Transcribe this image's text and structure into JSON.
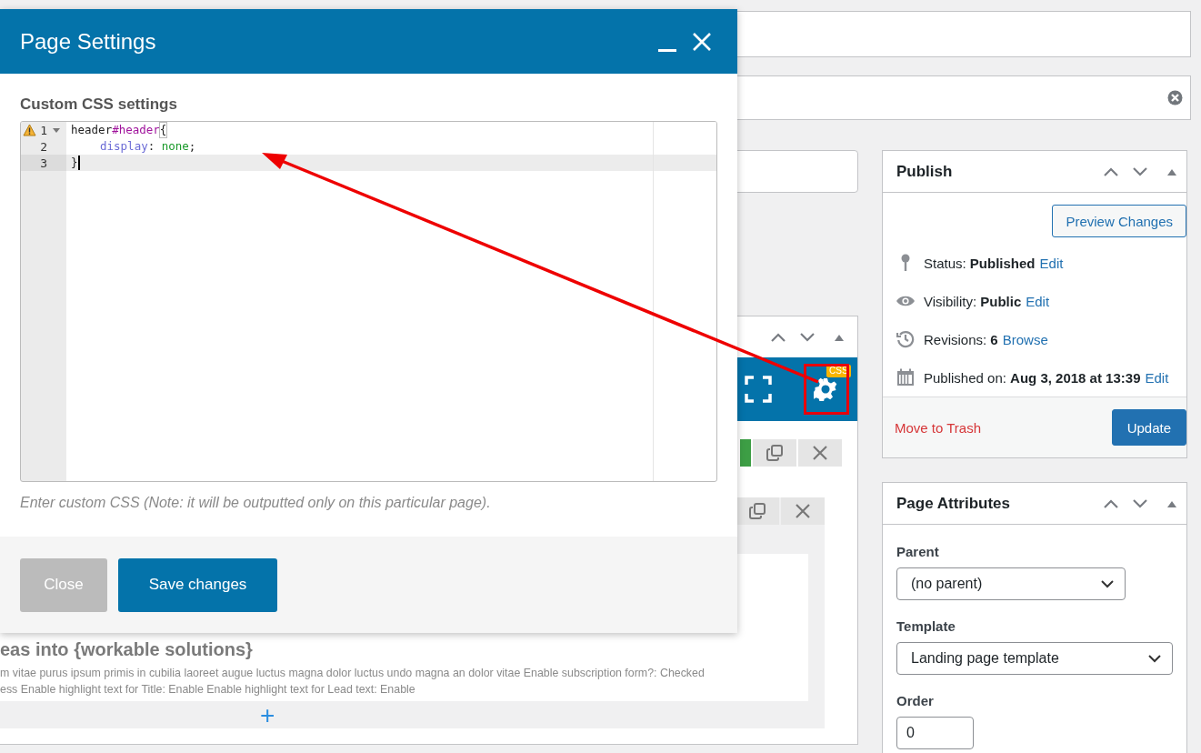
{
  "modal": {
    "title": "Page Settings",
    "section_label": "Custom CSS settings",
    "code_lines": [
      {
        "number": "1",
        "warning": true,
        "foldable": true,
        "active": false,
        "indent": false,
        "tokens": [
          {
            "text": "header",
            "kind": "tag"
          },
          {
            "text": "#header",
            "kind": "id"
          },
          {
            "text": "{",
            "kind": "bracket-match"
          }
        ]
      },
      {
        "number": "2",
        "warning": false,
        "foldable": false,
        "active": false,
        "indent": true,
        "tokens": [
          {
            "text": "display",
            "kind": "property"
          },
          {
            "text": ": ",
            "kind": "plain"
          },
          {
            "text": "none",
            "kind": "value"
          },
          {
            "text": ";",
            "kind": "plain"
          }
        ]
      },
      {
        "number": "3",
        "warning": false,
        "foldable": false,
        "active": true,
        "indent": false,
        "tokens": [
          {
            "text": "}",
            "kind": "plain"
          }
        ]
      }
    ],
    "hint": "Enter custom CSS (Note: it will be outputted only on this particular page).",
    "buttons": [
      {
        "label": "Close",
        "kind": "secondary"
      },
      {
        "label": "Save changes",
        "kind": "primary"
      }
    ]
  },
  "builder": {
    "badge": "CSS",
    "heading": "eas into {workable solutions}",
    "summary_lines": [
      "m vitae purus ipsum primis in cubilia laoreet augue luctus magna dolor luctus undo magna an dolor vitae  Enable subscription form?: Checked",
      "ess  Enable highlight text for Title: Enable  Enable highlight text for Lead text: Enable"
    ],
    "add_label": "+"
  },
  "publish": {
    "title": "Publish",
    "preview_button": "Preview Changes",
    "rows": [
      {
        "kind": "status",
        "text": "Status: **Published**",
        "link": "Edit"
      },
      {
        "kind": "visibility",
        "text": "Visibility: **Public**",
        "link": "Edit"
      },
      {
        "kind": "revisions",
        "text": "Revisions: **6**",
        "link": "Browse"
      },
      {
        "kind": "date",
        "text": "Published on: **Aug 3, 2018 at 13:39**",
        "link": "Edit"
      }
    ],
    "trash_link": "Move to Trash",
    "update_button": "Update"
  },
  "attributes": {
    "title": "Page Attributes",
    "fields": [
      {
        "kind": "select",
        "label": "Parent",
        "value": "(no parent)"
      },
      {
        "kind": "select",
        "label": "Template",
        "value": "Landing page template"
      },
      {
        "kind": "number",
        "label": "Order",
        "value": "0"
      }
    ]
  }
}
